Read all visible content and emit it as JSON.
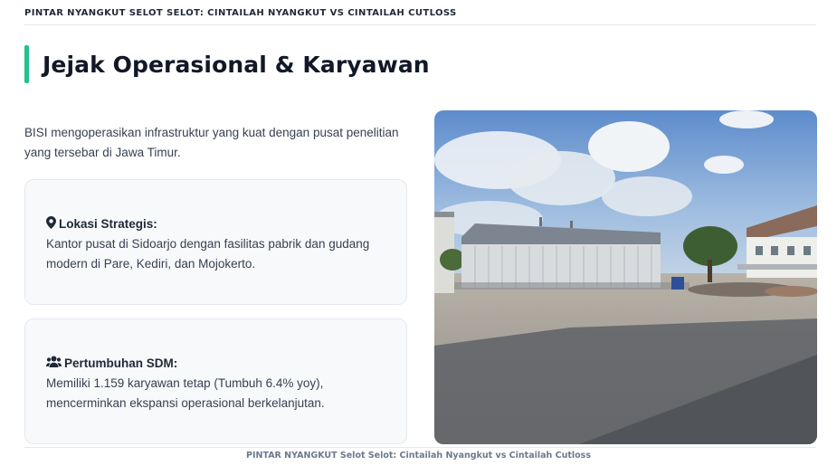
{
  "header": {
    "breadcrumb": "PINTAR NYANGKUT SELOT SELOT: CINTAILAH NYANGKUT VS CINTAILAH CUTLOSS"
  },
  "section": {
    "title": "Jejak Operasional & Karyawan",
    "intro_line1": "BISI mengoperasikan infrastruktur yang kuat dengan pusat penelitian",
    "intro_line2": "yang tersebar di Jawa Timur."
  },
  "cards": [
    {
      "icon": "map-marker-icon",
      "heading": "Lokasi Strategis:",
      "line1": "Kantor pusat di Sidoarjo dengan fasilitas pabrik dan gudang",
      "line2": "modern di Pare, Kediri, dan Mojokerto."
    },
    {
      "icon": "users-icon",
      "heading": "Pertumbuhan SDM:",
      "line1": "Memiliki 1.159 karyawan tetap (Tumbuh 6.4% yoy),",
      "line2": "mencerminkan ekspansi operasional berkelanjutan."
    }
  ],
  "footer": {
    "text": "PINTAR NYANGKUT Selot Selot: Cintailah Nyangkut vs Cintailah Cutloss"
  },
  "colors": {
    "accent": "#22c08c",
    "card_bg": "#f7f9fb"
  }
}
